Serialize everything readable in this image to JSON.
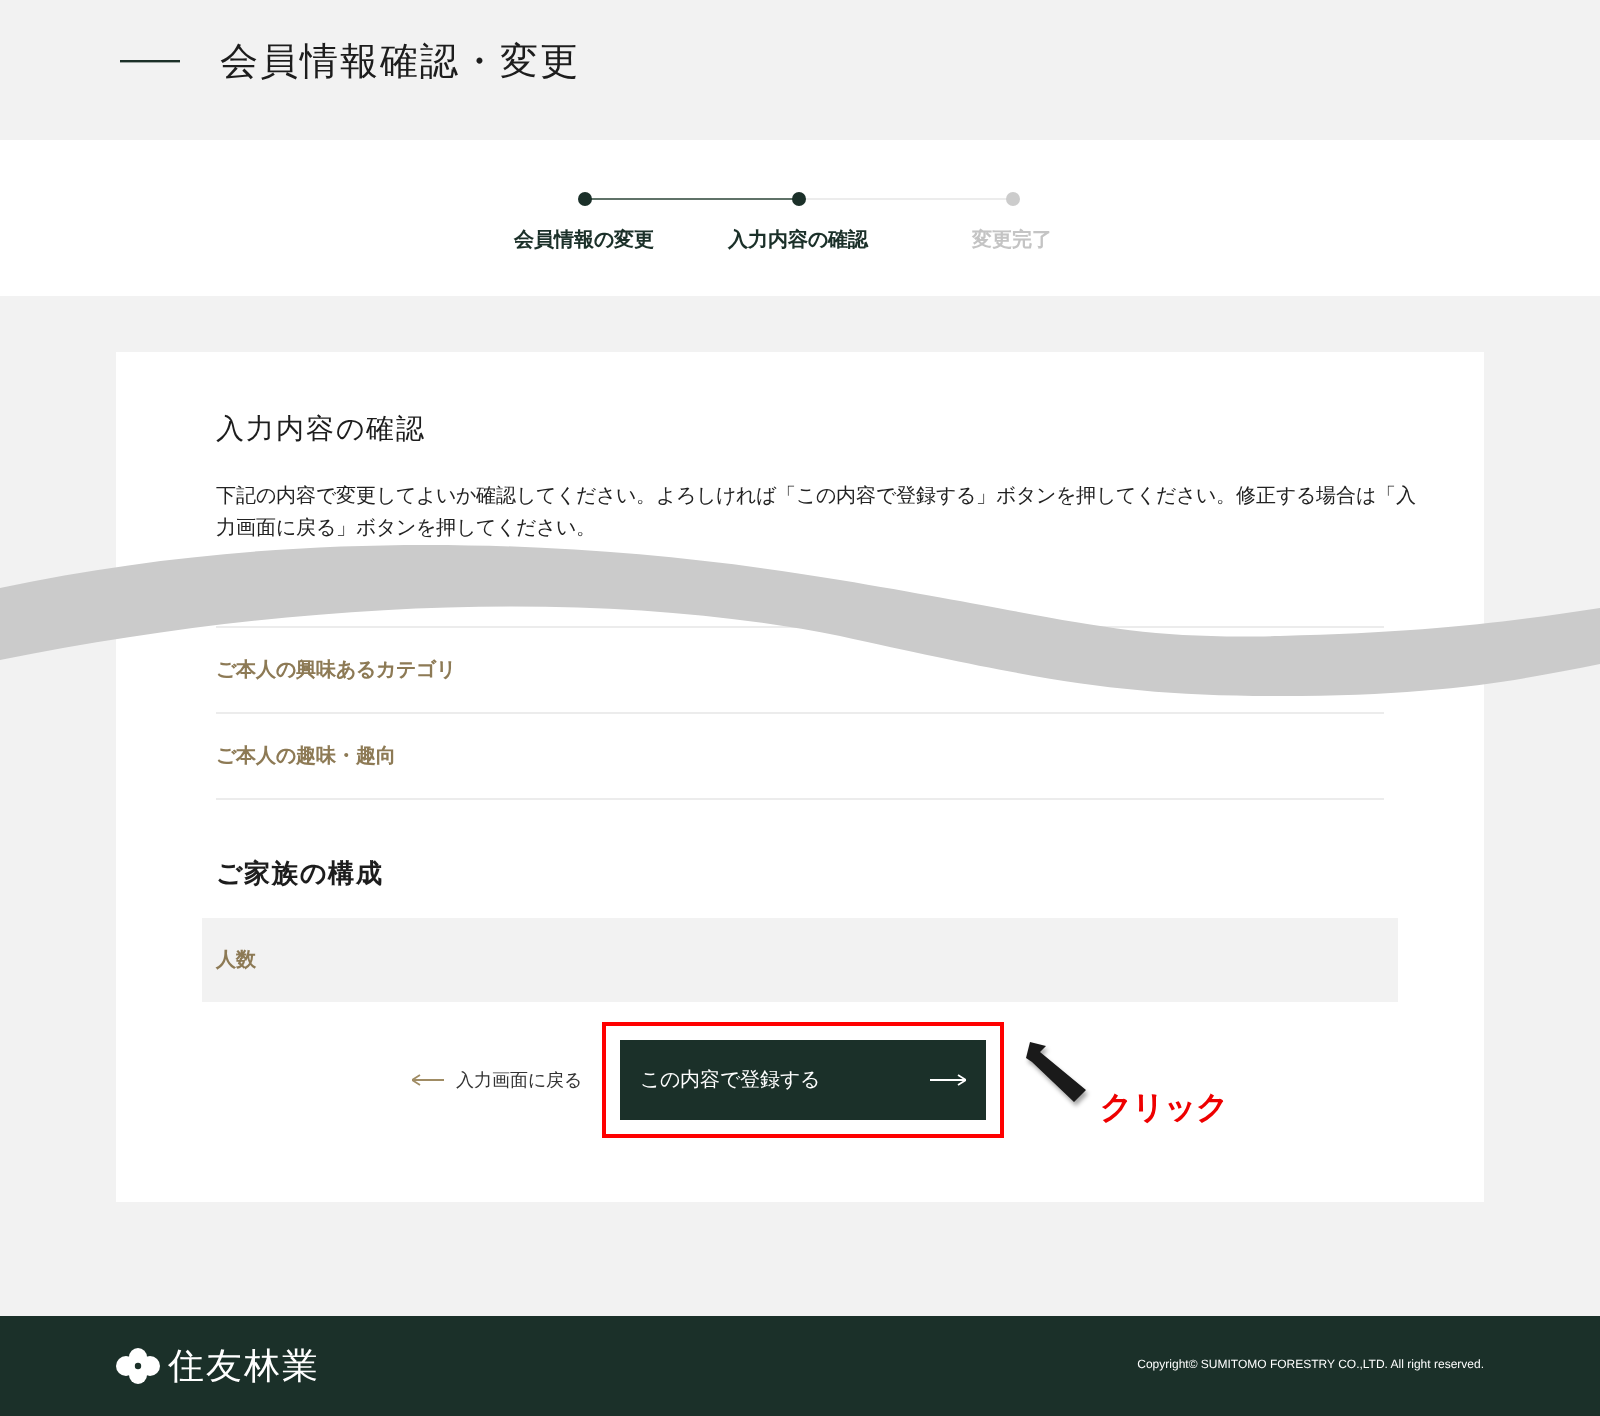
{
  "header": {
    "title": "会員情報確認・変更"
  },
  "steps": [
    {
      "label": "会員情報の変更",
      "reached": true
    },
    {
      "label": "入力内容の確認",
      "reached": true
    },
    {
      "label": "変更完了",
      "reached": false
    }
  ],
  "card": {
    "heading": "入力内容の確認",
    "description": "下記の内容で変更してよいか確認してください。よろしければ「この内容で登録する」ボタンを押してください。修正する場合は「入力画面に戻る」ボタンを押してください。",
    "fields": [
      {
        "label": "ご本人の興味あるカテゴリ",
        "shaded": false
      },
      {
        "label": "ご本人の趣味・趣向",
        "shaded": false
      }
    ],
    "section": {
      "heading": "ご家族の構成",
      "rows": [
        {
          "label": "人数",
          "shaded": true
        }
      ]
    },
    "back_link": "入力画面に戻る",
    "submit": "この内容で登録する"
  },
  "annotation": {
    "label": "クリック"
  },
  "footer": {
    "logo": "住友林業",
    "copyright": "Copyright© SUMITOMO FORESTRY CO.,LTD. All right reserved."
  }
}
